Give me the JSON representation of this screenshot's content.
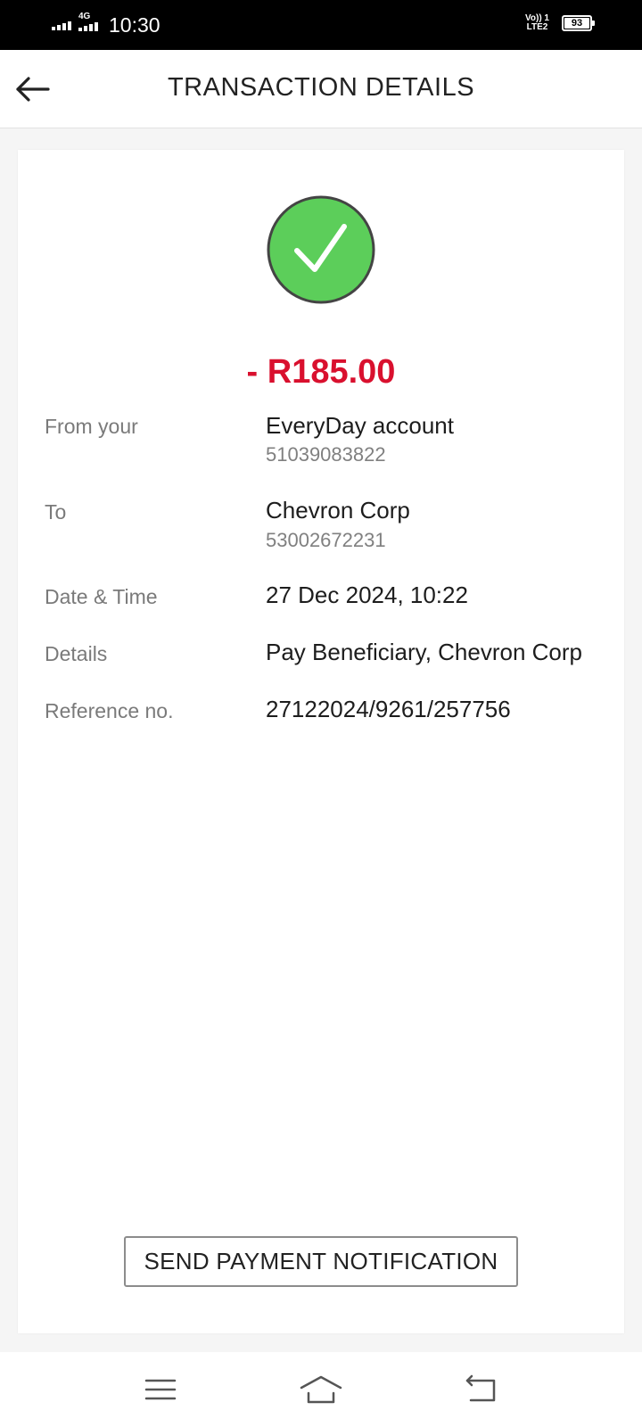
{
  "status_bar": {
    "network_label": "4G",
    "time": "10:30",
    "volte_line1": "Vo)) 1",
    "volte_line2": "LTE2",
    "battery_level": "93"
  },
  "header": {
    "back_icon": "arrow-left-icon",
    "title": "TRANSACTION DETAILS"
  },
  "transaction": {
    "status_icon": "checkmark-circle-icon",
    "status_color": "#5cce5a",
    "amount": "- R185.00",
    "amount_color": "#d9102e",
    "from": {
      "label": "From your",
      "value": "EveryDay account",
      "sub": "51039083822"
    },
    "to": {
      "label": "To",
      "value": "Chevron Corp",
      "sub": "53002672231"
    },
    "date_time": {
      "label": "Date & Time",
      "value": "27 Dec 2024, 10:22"
    },
    "details": {
      "label": "Details",
      "value": "Pay Beneficiary, Chevron Corp"
    },
    "reference": {
      "label": "Reference no.",
      "value": "27122024/9261/257756"
    }
  },
  "actions": {
    "send_notification_label": "SEND PAYMENT NOTIFICATION"
  },
  "nav_bar": {
    "menu_icon": "menu-icon",
    "home_icon": "home-icon",
    "back_icon": "back-icon"
  }
}
